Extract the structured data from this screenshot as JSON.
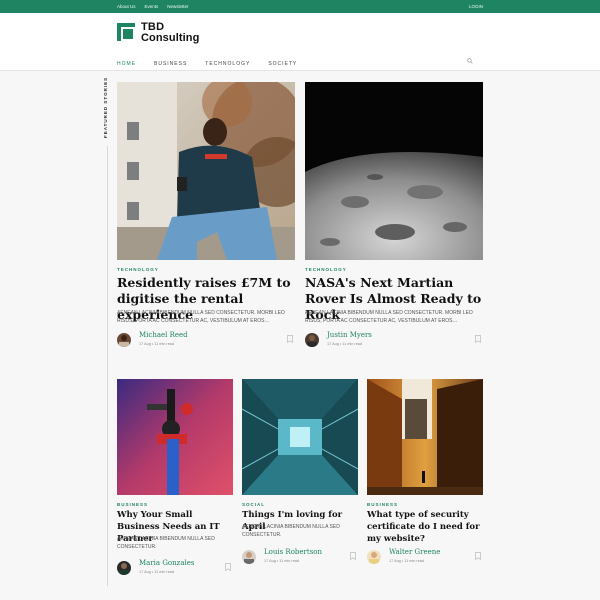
{
  "topbar": {
    "links": [
      "About Us",
      "Events",
      "Newsletter"
    ],
    "login": "LOGIN"
  },
  "brand": {
    "line1": "TBD",
    "line2": "Consulting"
  },
  "nav": {
    "tabs": [
      "HOME",
      "BUSINESS",
      "TECHNOLOGY",
      "SOCIETY"
    ],
    "active": "HOME"
  },
  "sidebar": {
    "label": "FEATURED STORIES"
  },
  "colors": {
    "accent": "#1e8462",
    "background": "#f7f7f7"
  },
  "featured": [
    {
      "category": "TECHNOLOGY",
      "title": "Residently raises £7M to digitise the rental experience",
      "excerpt": "AENEAN LACINIA BIBENDUM NULLA SED CONSECTETUR. MORBI LEO RISUS, PORTA AC CONSECTETUR AC, VESTIBULUM AT EROS…",
      "author": "Michael Reed",
      "meta": "17 Aug • 11 min read",
      "image": "man-sitting-with-phone"
    },
    {
      "category": "TECHNOLOGY",
      "title": "NASA's Next Martian Rover Is Almost Ready to Rock",
      "excerpt": "AENEAN LACINIA BIBENDUM NULLA SED CONSECTETUR. MORBI LEO RISUS, PORTA AC CONSECTETUR AC, VESTIBULUM AT EROS…",
      "author": "Justin Myers",
      "meta": "17 Aug • 11 min read",
      "image": "moon-surface"
    }
  ],
  "cards": [
    {
      "category": "BUSINESS",
      "title": "Why Your Small Business Needs an IT Partner",
      "excerpt": "AENEAN LACINIA BIBENDUM NULLA SED CONSECTETUR.",
      "author": "Maria Gonzales",
      "meta": "17 Aug • 11 min read",
      "image": "camera-gimbal"
    },
    {
      "category": "SOCIAL",
      "title": "Things I'm loving for April",
      "excerpt": "AENEAN LACINIA BIBENDUM NULLA SED CONSECTETUR.",
      "author": "Louis Robertson",
      "meta": "17 Aug • 11 min read",
      "image": "tunnel-machine"
    },
    {
      "category": "BUSINESS",
      "title": "What type of security certificate do I need for my website?",
      "excerpt": "",
      "author": "Walter Greene",
      "meta": "17 Aug • 11 min read",
      "image": "buildings-sunlight"
    }
  ]
}
